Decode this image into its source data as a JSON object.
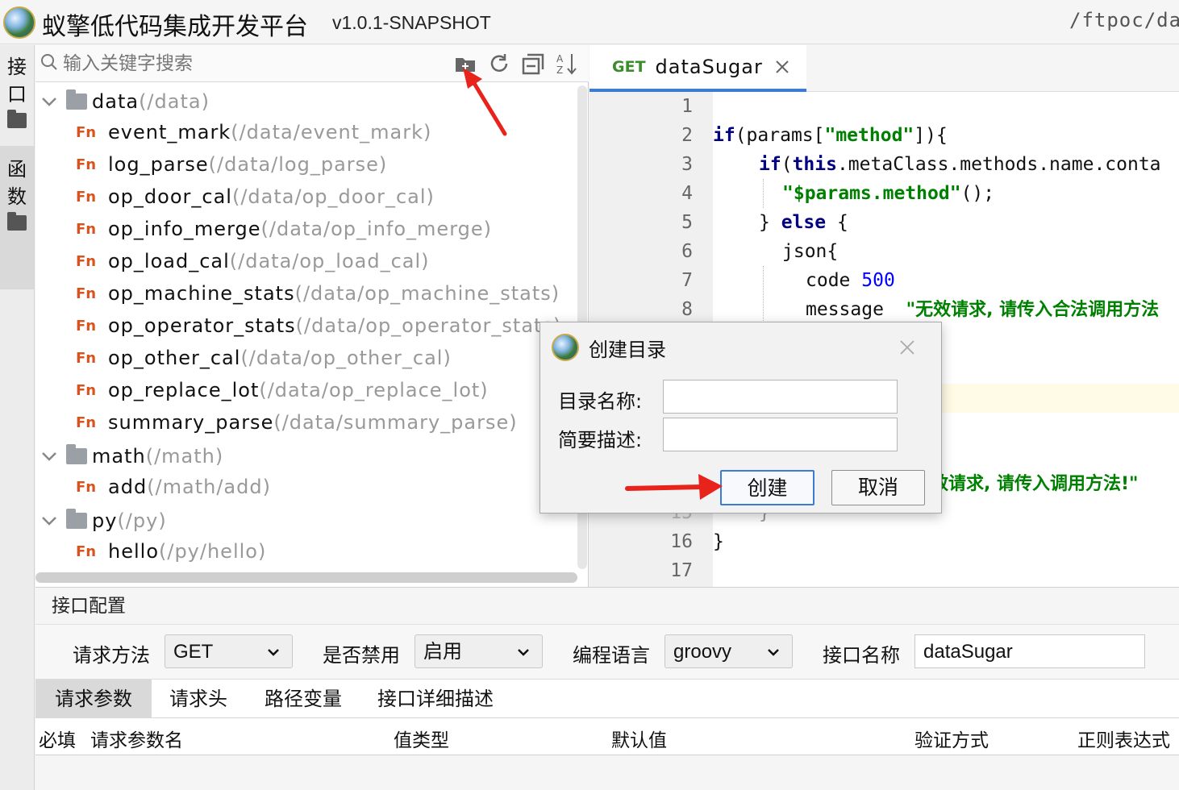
{
  "window": {
    "title": "蚁擎低代码集成开发平台",
    "version": "v1.0.1-SNAPSHOT",
    "path": "/ftpoc/dat"
  },
  "sidebar": {
    "tabs": [
      {
        "label": "接口",
        "icon": "folder-icon",
        "active": false
      },
      {
        "label": "函数",
        "icon": "folder-icon",
        "active": true
      }
    ]
  },
  "tree": {
    "search_placeholder": "输入关键字搜索",
    "toolbar": [
      "new-folder-icon",
      "refresh-icon",
      "collapse-all-icon",
      "sort-az-icon"
    ],
    "nodes": [
      {
        "type": "folder",
        "name": "data",
        "path": "(/data)"
      },
      {
        "type": "fn",
        "badge": "Fn",
        "name": "event_mark",
        "path": "(/data/event_mark)"
      },
      {
        "type": "fn",
        "badge": "Fn",
        "name": "log_parse",
        "path": "(/data/log_parse)"
      },
      {
        "type": "fn",
        "badge": "Fn",
        "name": "op_door_cal",
        "path": "(/data/op_door_cal)"
      },
      {
        "type": "fn",
        "badge": "Fn",
        "name": "op_info_merge",
        "path": "(/data/op_info_merge)"
      },
      {
        "type": "fn",
        "badge": "Fn",
        "name": "op_load_cal",
        "path": "(/data/op_load_cal)"
      },
      {
        "type": "fn",
        "badge": "Fn",
        "name": "op_machine_stats",
        "path": "(/data/op_machine_stats)"
      },
      {
        "type": "fn",
        "badge": "Fn",
        "name": "op_operator_stats",
        "path": "(/data/op_operator_stats)"
      },
      {
        "type": "fn",
        "badge": "Fn",
        "name": "op_other_cal",
        "path": "(/data/op_other_cal)"
      },
      {
        "type": "fn",
        "badge": "Fn",
        "name": "op_replace_lot",
        "path": "(/data/op_replace_lot)"
      },
      {
        "type": "fn",
        "badge": "Fn",
        "name": "summary_parse",
        "path": "(/data/summary_parse)"
      },
      {
        "type": "folder",
        "name": "math",
        "path": "(/math)"
      },
      {
        "type": "fn",
        "badge": "Fn",
        "name": "add",
        "path": "(/math/add)"
      },
      {
        "type": "folder",
        "name": "py",
        "path": "(/py)"
      },
      {
        "type": "fn",
        "badge": "Fn",
        "name": "hello",
        "path": "(/py/hello)"
      }
    ]
  },
  "editor": {
    "tab": {
      "method": "GET",
      "name": "dataSugar"
    },
    "line_numbers": [
      "1",
      "2",
      "3",
      "4",
      "5",
      "6",
      "7",
      "8",
      "15",
      "16",
      "17"
    ],
    "code": {
      "l2_kw": "if",
      "l2_a": "(params[",
      "l2_str": "\"method\"",
      "l2_b": "]){",
      "l3_kw": "if",
      "l3_a": "(",
      "l3_kw2": "this",
      "l3_b": ".metaClass.methods.name.conta",
      "l4_str": "\"$params.method\"",
      "l4_b": "();",
      "l5_a": "} ",
      "l5_kw": "else",
      "l5_b": " {",
      "l6": "json{",
      "l7_a": "code ",
      "l7_num": "500",
      "l8_a": "message  ",
      "l8_str": "\"无效请求, 请传入合法调用方法",
      "l14_str": "效请求, 请传入调用方法!\"",
      "l15": "}",
      "l16": "}"
    }
  },
  "dialog": {
    "title": "创建目录",
    "name_label": "目录名称:",
    "desc_label": "简要描述:",
    "name_value": "",
    "desc_value": "",
    "create_button": "创建",
    "cancel_button": "取消"
  },
  "config": {
    "title": "接口配置",
    "fields": {
      "method_label": "请求方法",
      "method_value": "GET",
      "disabled_label": "是否禁用",
      "disabled_value": "启用",
      "lang_label": "编程语言",
      "lang_value": "groovy",
      "name_label": "接口名称",
      "name_value": "dataSugar"
    },
    "subtabs": [
      "请求参数",
      "请求头",
      "路径变量",
      "接口详细描述"
    ],
    "columns": [
      "必填",
      "请求参数名",
      "值类型",
      "默认值",
      "验证方式",
      "正则表达式"
    ]
  },
  "colors": {
    "accent": "#3a7bd5",
    "fn_badge": "#d9531e",
    "method_get": "#3a8d2b",
    "arrow": "#e8231b"
  }
}
